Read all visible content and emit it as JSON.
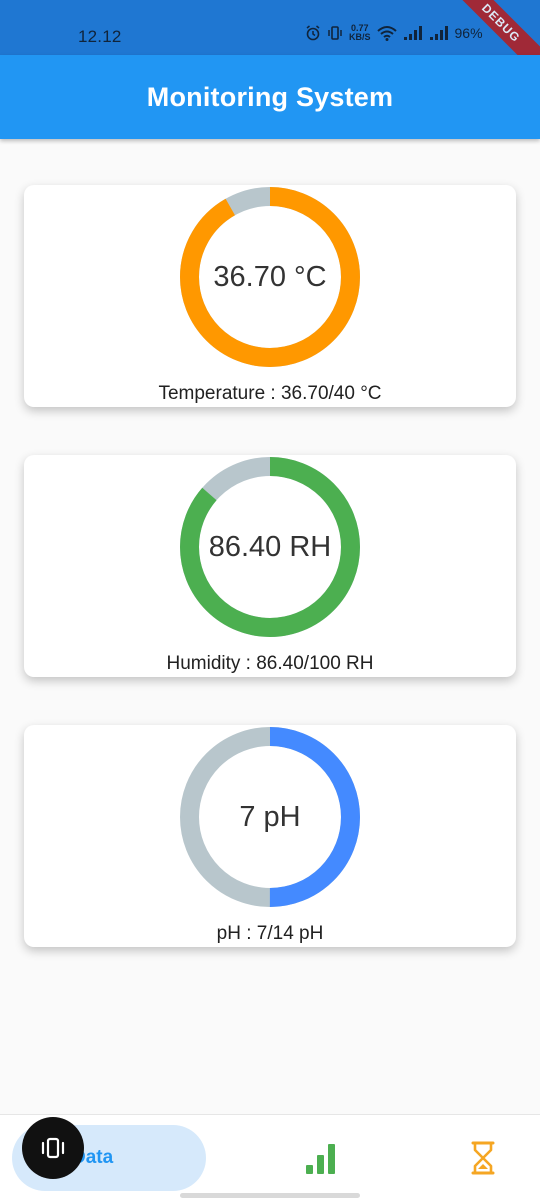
{
  "status_bar": {
    "time": "12.12",
    "net_speed_value": "0.77",
    "net_speed_unit": "KB/S",
    "battery": "96%",
    "debug_label": "DEBUG"
  },
  "app_bar": {
    "title": "Monitoring System"
  },
  "gauges": [
    {
      "center_text": "36.70 °C",
      "caption": "Temperature : 36.70/40 °C",
      "value": 36.7,
      "max": 40,
      "color": "#ff9800",
      "track_color": "#b8c6cc"
    },
    {
      "center_text": "86.40 RH",
      "caption": "Humidity : 86.40/100 RH",
      "value": 86.4,
      "max": 100,
      "color": "#4caf50",
      "track_color": "#b8c6cc"
    },
    {
      "center_text": "7 pH",
      "caption": "pH : 7/14 pH",
      "value": 7,
      "max": 14,
      "color": "#448aff",
      "track_color": "#b8c6cc"
    }
  ],
  "bottom_nav": {
    "items": [
      {
        "label": "Data",
        "icon": "data-icon",
        "active": true
      },
      {
        "icon": "signal-bars-icon"
      },
      {
        "icon": "hourglass-icon"
      }
    ],
    "active_color": "#2196f3",
    "active_bg": "#d6e9fb"
  }
}
